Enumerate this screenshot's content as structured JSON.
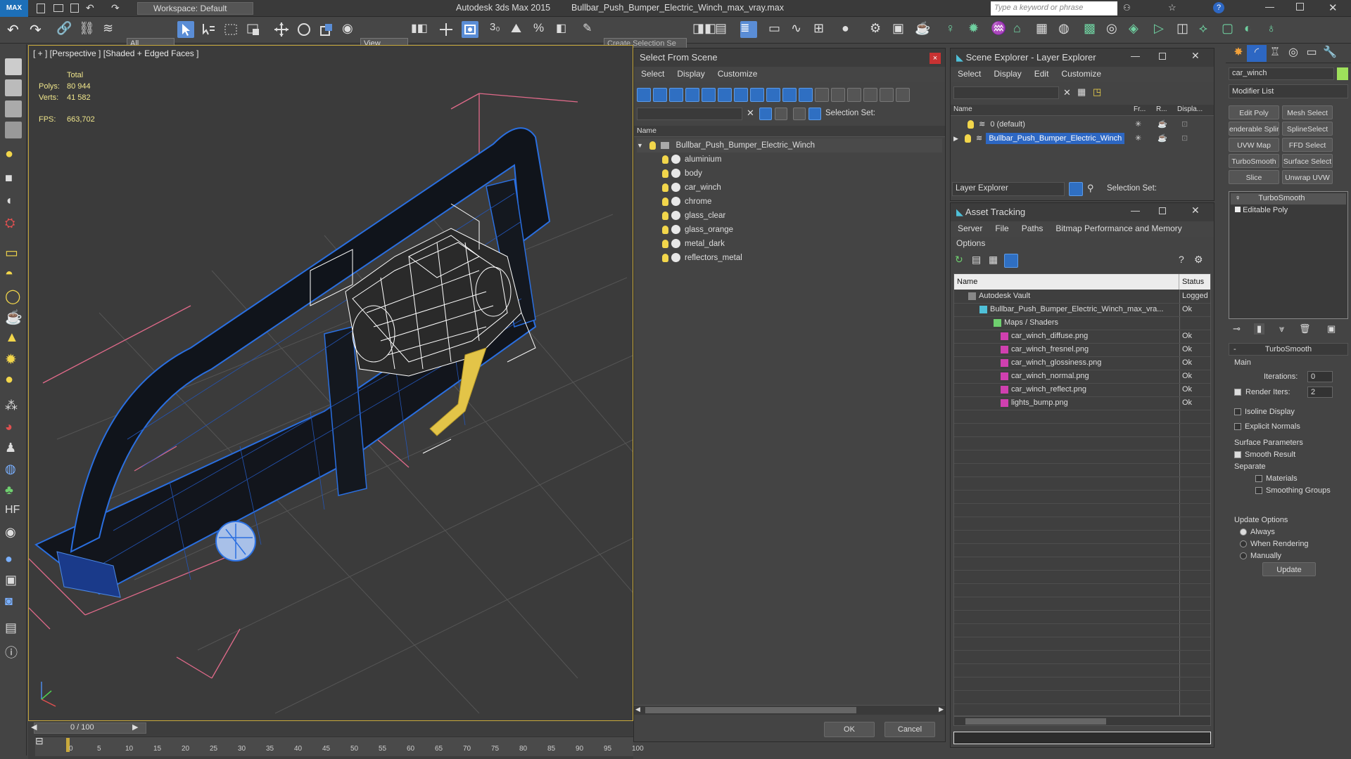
{
  "app": {
    "title": "Autodesk 3ds Max  2015",
    "file": "Bullbar_Push_Bumper_Electric_Winch_max_vray.max",
    "logo": "MAX",
    "workspace": "Workspace: Default",
    "search_placeholder": "Type a keyword or phrase"
  },
  "toolbar": {
    "filter_value": "All",
    "view_value": "View",
    "create_selection_set": "Create Selection Se"
  },
  "viewport": {
    "label": "[ + ] [Perspective ] [Shaded + Edged Faces ]",
    "stats": {
      "total_label": "Total",
      "polys_label": "Polys:",
      "polys": "80 944",
      "verts_label": "Verts:",
      "verts": "41 582",
      "fps_label": "FPS:",
      "fps": "663,702"
    }
  },
  "timeline": {
    "frame": "0 / 100",
    "ticks": [
      "0",
      "5",
      "10",
      "15",
      "20",
      "25",
      "30",
      "35",
      "40",
      "45",
      "50",
      "55",
      "60",
      "65",
      "70",
      "75",
      "80",
      "85",
      "90",
      "95",
      "100"
    ]
  },
  "select_from_scene": {
    "title": "Select From Scene",
    "menu": [
      "Select",
      "Display",
      "Customize"
    ],
    "selection_set_label": "Selection Set:",
    "column_name": "Name",
    "root": "Bullbar_Push_Bumper_Electric_Winch",
    "items": [
      "aluminium",
      "body",
      "car_winch",
      "chrome",
      "glass_clear",
      "glass_orange",
      "metal_dark",
      "reflectors_metal"
    ],
    "ok": "OK",
    "cancel": "Cancel"
  },
  "scene_explorer": {
    "title": "Scene Explorer - Layer Explorer",
    "menu": [
      "Select",
      "Display",
      "Edit",
      "Customize"
    ],
    "columns": [
      "Name",
      "Fr...",
      "R...",
      "Displa..."
    ],
    "layers": [
      "0 (default)",
      "Bullbar_Push_Bumper_Electric_Winch"
    ],
    "footer_dropdown": "Layer Explorer",
    "selection_set_label": "Selection Set:"
  },
  "asset_tracking": {
    "title": "Asset Tracking",
    "menu": [
      "Server",
      "File",
      "Paths",
      "Bitmap Performance and Memory"
    ],
    "menu2": "Options",
    "columns": [
      "Name",
      "Status"
    ],
    "rows": [
      {
        "name": "Autodesk Vault",
        "status": "Logged"
      },
      {
        "name": "Bullbar_Push_Bumper_Electric_Winch_max_vra...",
        "status": "Ok"
      },
      {
        "name": "Maps / Shaders",
        "status": ""
      },
      {
        "name": "car_winch_diffuse.png",
        "status": "Ok"
      },
      {
        "name": "car_winch_fresnel.png",
        "status": "Ok"
      },
      {
        "name": "car_winch_glossiness.png",
        "status": "Ok"
      },
      {
        "name": "car_winch_normal.png",
        "status": "Ok"
      },
      {
        "name": "car_winch_reflect.png",
        "status": "Ok"
      },
      {
        "name": "lights_bump.png",
        "status": "Ok"
      }
    ]
  },
  "command_panel": {
    "object_name": "car_winch",
    "modifier_list": "Modifier List",
    "buttons": [
      "Edit Poly",
      "Mesh Select",
      "enderable Splir",
      "SplineSelect",
      "UVW Map",
      "FFD Select",
      "TurboSmooth",
      "Surface Select",
      "Slice",
      "Unwrap UVW"
    ],
    "stack": [
      "TurboSmooth",
      "Editable Poly"
    ],
    "rollout_title": "TurboSmooth",
    "main_label": "Main",
    "iterations_label": "Iterations:",
    "iterations": "0",
    "render_iters_label": "Render Iters:",
    "render_iters": "2",
    "isoline": "Isoline Display",
    "explicit_normals": "Explicit Normals",
    "surface_params": "Surface Parameters",
    "smooth_result": "Smooth Result",
    "separate": "Separate",
    "materials": "Materials",
    "smoothing_groups": "Smoothing Groups",
    "update_options": "Update Options",
    "always": "Always",
    "when_rendering": "When Rendering",
    "manually": "Manually",
    "update": "Update"
  },
  "colors": {
    "accent": "#2d67c3",
    "wire": "#1f5fd6",
    "yellow": "#c8a93c"
  }
}
